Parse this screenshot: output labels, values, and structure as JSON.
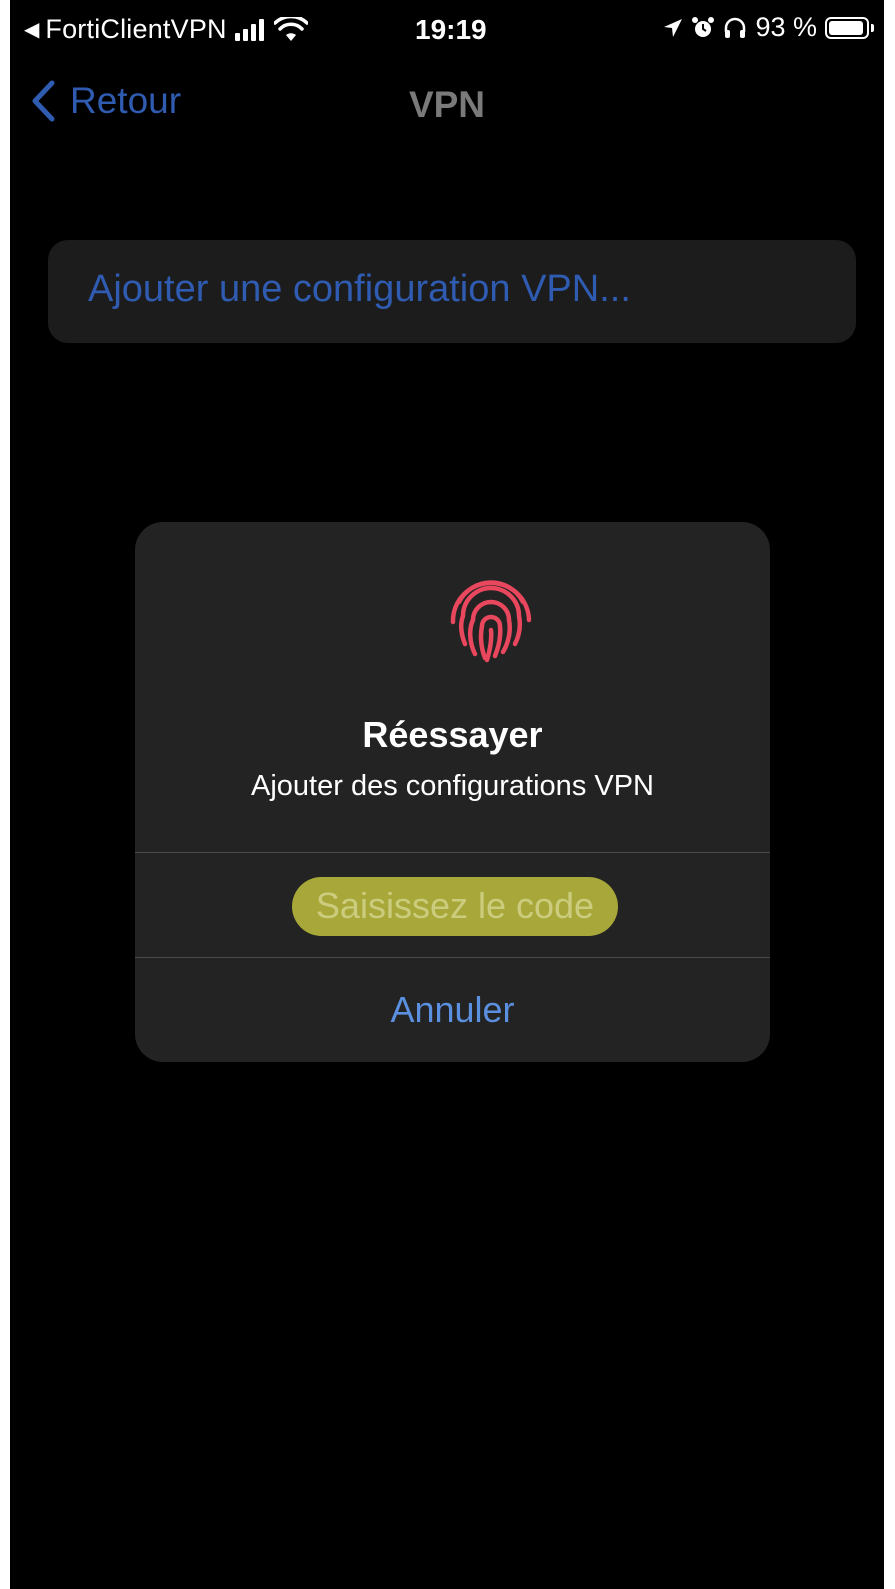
{
  "status_bar": {
    "back_app": "FortiClientVPN",
    "time": "19:19",
    "battery": "93 %"
  },
  "nav": {
    "back_label": "Retour",
    "title": "VPN"
  },
  "settings": {
    "add_vpn_label": "Ajouter une configuration VPN..."
  },
  "alert": {
    "icon": "fingerprint-icon",
    "icon_color": "#e8475d",
    "title": "Réessayer",
    "message": "Ajouter des configurations VPN",
    "enter_code_label": "Saisissez le code",
    "cancel_label": "Annuler"
  },
  "colors": {
    "background": "#000000",
    "link_blue": "#2f5bb0",
    "alert_button_blue": "#5b8fe0",
    "highlight": "#a8a83a"
  }
}
